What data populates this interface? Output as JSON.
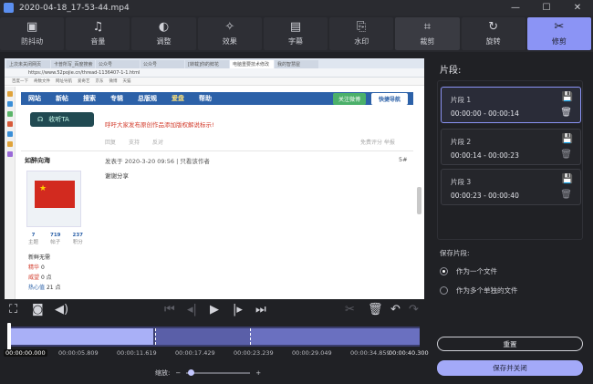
{
  "window": {
    "title": "2020-04-18_17-53-44.mp4",
    "controls": [
      "minimize-icon",
      "maximize-icon",
      "close-icon"
    ]
  },
  "toolbar": {
    "tools": [
      {
        "label": "防抖动",
        "icon": "stabilize-icon",
        "glyph": "▣"
      },
      {
        "label": "音量",
        "icon": "music-note-icon",
        "glyph": "♫"
      },
      {
        "label": "调整",
        "icon": "adjust-icon",
        "glyph": "◐"
      },
      {
        "label": "效果",
        "icon": "magic-wand-icon",
        "glyph": "✧"
      },
      {
        "label": "字幕",
        "icon": "subtitle-icon",
        "glyph": "▤"
      },
      {
        "label": "水印",
        "icon": "watermark-icon",
        "glyph": "⎘"
      },
      {
        "label": "裁剪",
        "icon": "crop-icon",
        "glyph": "⌗"
      },
      {
        "label": "旋转",
        "icon": "rotate-icon",
        "glyph": "↻"
      },
      {
        "label": "修剪",
        "icon": "scissors-icon",
        "glyph": "✂"
      }
    ],
    "active_index": 8,
    "highlight_index": 6,
    "accent": "#8b94f5"
  },
  "preview": {
    "tabs": [
      "上次未关闭网页",
      "卡普所写_百度搜索",
      "公众号",
      "公众号",
      "[转载]你的鲜花",
      "电脑重要技术修改",
      "我的智慧屋"
    ],
    "address": "https://www.52pojie.cn/thread-1136407-1-1.html",
    "bookmarks": [
      "百度一下",
      "奇数文件",
      "网址导航",
      "爱奇艺",
      "京东",
      "微博",
      "天猫"
    ],
    "nav": [
      "网站",
      "新帖",
      "搜索",
      "专辑",
      "总版规",
      "爱盘",
      "帮助"
    ],
    "follow": "关注微博",
    "quick_nav": "快捷导航",
    "listen": "收听TA",
    "notice": "呼吁大家发布原创作品添加版权解说标示!",
    "tools_row": [
      "回复",
      "支持",
      "反对"
    ],
    "tools_right": "免费评分 举报",
    "user": "如醉向海",
    "post_meta": "发表于 2020-3-20 09:56 | 只看该作者",
    "floor": "5#",
    "post_body": "谢谢分享",
    "stats": [
      {
        "v": "7",
        "k": "主题"
      },
      {
        "v": "719",
        "k": "帖子"
      },
      {
        "v": "237",
        "k": "积分"
      }
    ],
    "user_lines": [
      {
        "k": "精华",
        "v": "0"
      },
      {
        "k": "威望",
        "v": "0 点"
      },
      {
        "k": "热心值",
        "v": "21 点"
      }
    ],
    "rank": "新鲜无需"
  },
  "player": {
    "icons": [
      "fullscreen-icon",
      "snapshot-camera-icon",
      "volume-icon",
      "skip-start-icon",
      "step-back-icon",
      "play-icon",
      "step-forward-icon",
      "skip-end-icon",
      "cut-scissors-icon",
      "delete-icon",
      "undo-icon",
      "redo-icon"
    ]
  },
  "timeline": {
    "current": "00:00:00.000",
    "ticks": [
      "00:00:05.809",
      "00:00:11.619",
      "00:00:17.429",
      "00:00:23.239",
      "00:00:29.049",
      "00:00:34.859",
      "00:00:40.300"
    ],
    "zoom_label": "缩放:",
    "zoom_minus": "−",
    "zoom_plus": "+",
    "zoom_level": 0.05
  },
  "right_panel": {
    "title": "片段:",
    "clips": [
      {
        "name": "片段 1",
        "range": "00:00:00 - 00:00:14",
        "selected": true
      },
      {
        "name": "片段 2",
        "range": "00:00:14 - 00:00:23",
        "selected": false
      },
      {
        "name": "片段 3",
        "range": "00:00:23 - 00:00:40",
        "selected": false
      }
    ],
    "save_title": "保存片段:",
    "options": [
      {
        "label": "作为一个文件",
        "checked": true
      },
      {
        "label": "作为多个单独的文件",
        "checked": false
      }
    ],
    "reset": "重置",
    "save_close": "保存并关闭"
  }
}
